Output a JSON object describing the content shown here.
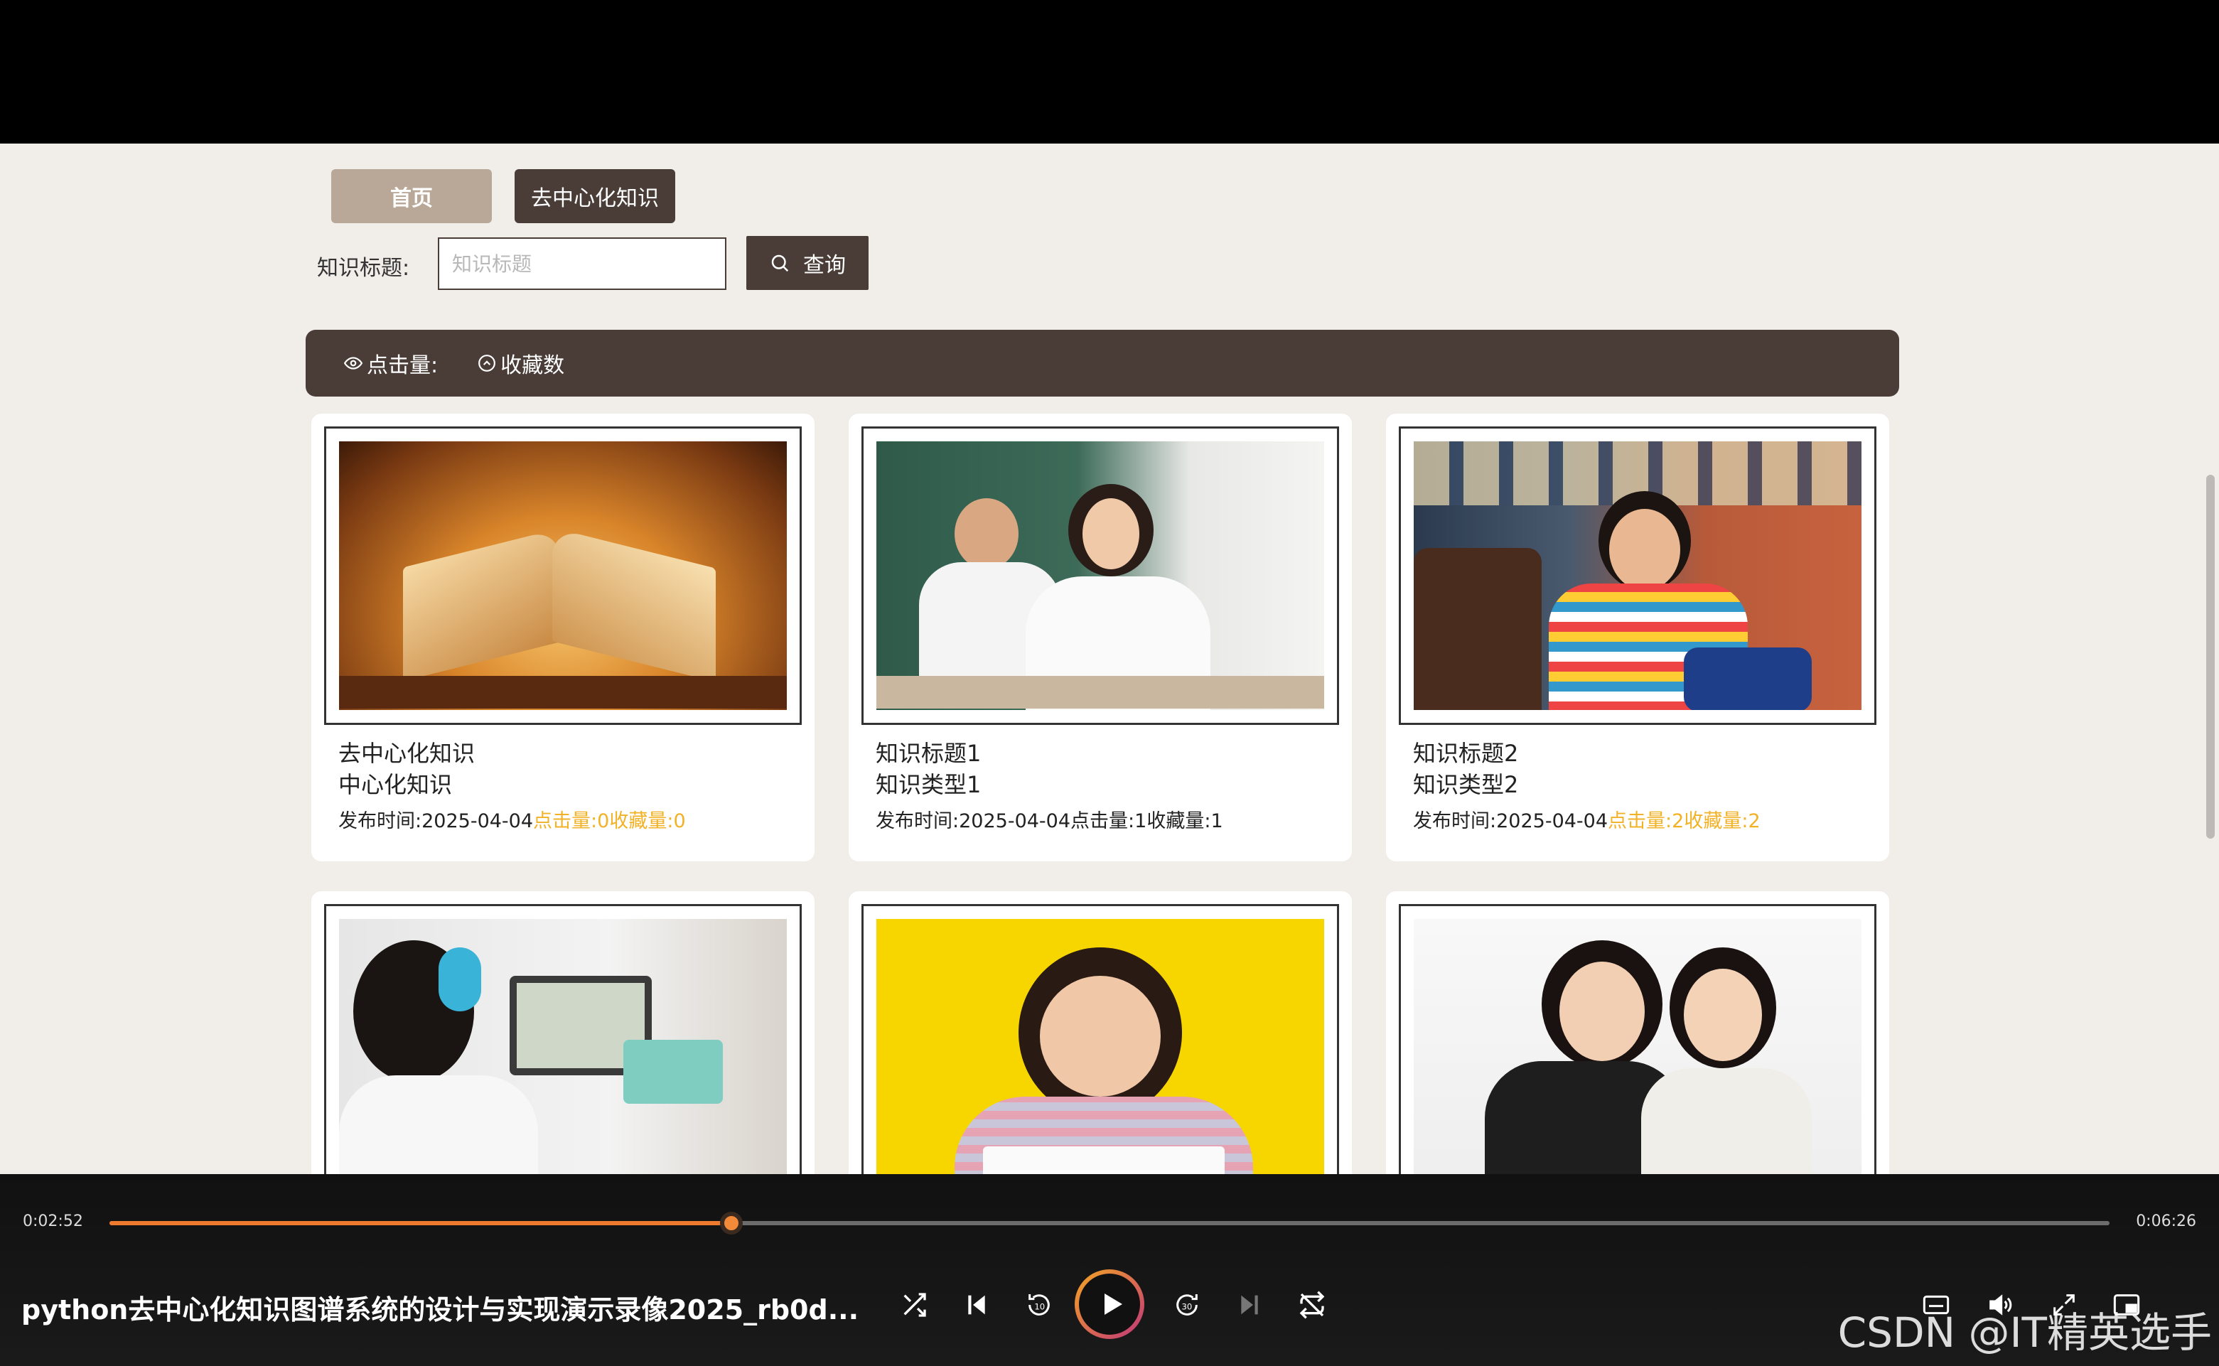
{
  "nav": {
    "home": "首页",
    "knowledge": "去中心化知识"
  },
  "search": {
    "label": "知识标题:",
    "placeholder": "知识标题",
    "button": "查询"
  },
  "sort": {
    "clicks": "点击量:",
    "favorites": "收藏数"
  },
  "cards": [
    {
      "title": "去中心化知识",
      "type": "中心化知识",
      "date_label": "发布时间:",
      "date": "2025-04-04",
      "clicks_label": "点击量:",
      "clicks": "0",
      "fav_label": "收藏量:",
      "fav": "0"
    },
    {
      "title": "知识标题1",
      "type": "知识类型1",
      "date_label": "发布时间:",
      "date": "2025-04-04",
      "clicks_label": "点击量:",
      "clicks": "1",
      "fav_label": "收藏量:",
      "fav": "1"
    },
    {
      "title": "知识标题2",
      "type": "知识类型2",
      "date_label": "发布时间:",
      "date": "2025-04-04",
      "clicks_label": "点击量:",
      "clicks": "2",
      "fav_label": "收藏量:",
      "fav": "2"
    },
    {},
    {},
    {}
  ],
  "player": {
    "current_time": "0:02:52",
    "total_time": "0:06:26",
    "progress": 0.311,
    "title": "python去中心化知识图谱系统的设计与实现演示录像2025_rb0d..."
  },
  "watermark": "CSDN @IT精英选手",
  "colors": {
    "accent_dark": "#4a3d38",
    "accent_light": "#b9a898",
    "highlight": "#f2b227",
    "progress": "#ee7a2e"
  }
}
